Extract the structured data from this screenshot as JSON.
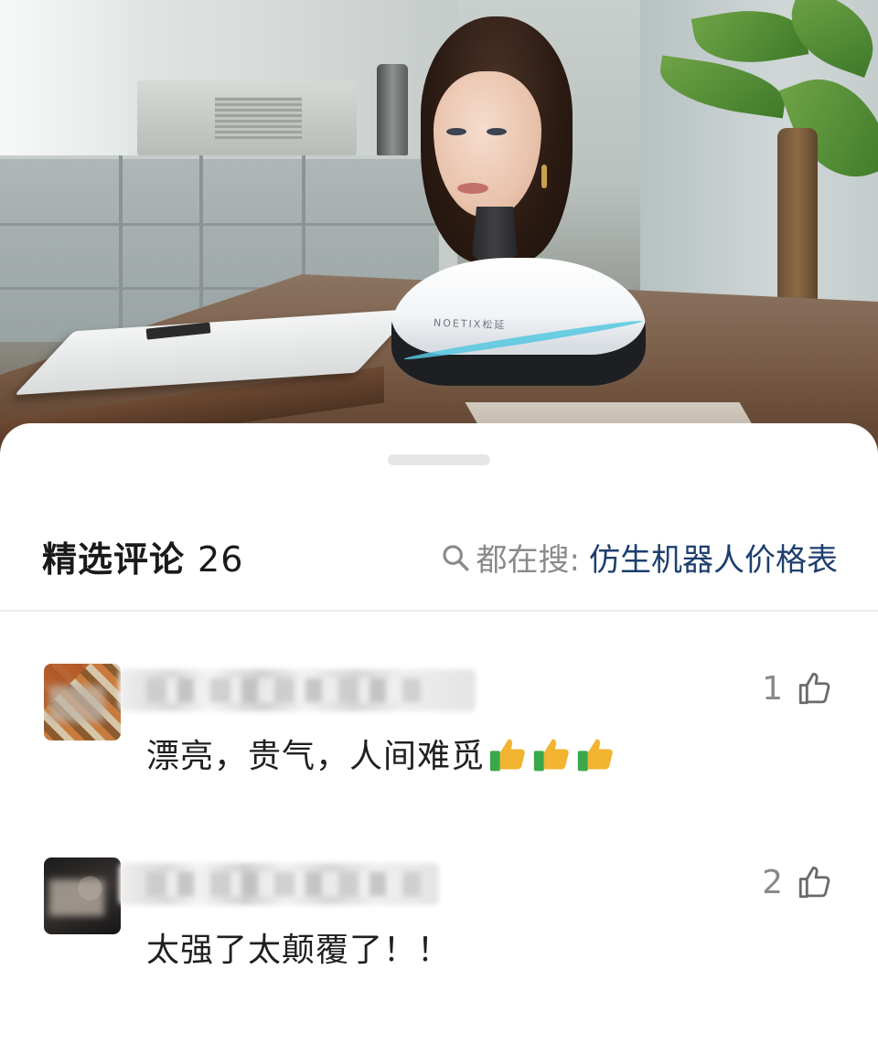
{
  "header": {
    "title": "精选评论",
    "count": "26",
    "search_label": "都在搜:",
    "search_term": "仿生机器人价格表"
  },
  "hero": {
    "brand_text": "NOETIX松延"
  },
  "comments": [
    {
      "text": "漂亮，贵气，人间难觅",
      "emoji": [
        "thumbs-up-icon",
        "thumbs-up-icon",
        "thumbs-up-icon"
      ],
      "likes": "1"
    },
    {
      "text": "太强了太颠覆了！！",
      "likes": "2"
    }
  ],
  "colors": {
    "title": "#1a1a1a",
    "search_term": "#1e3f6e",
    "muted": "#8a8a8a",
    "divider": "#ededed"
  }
}
